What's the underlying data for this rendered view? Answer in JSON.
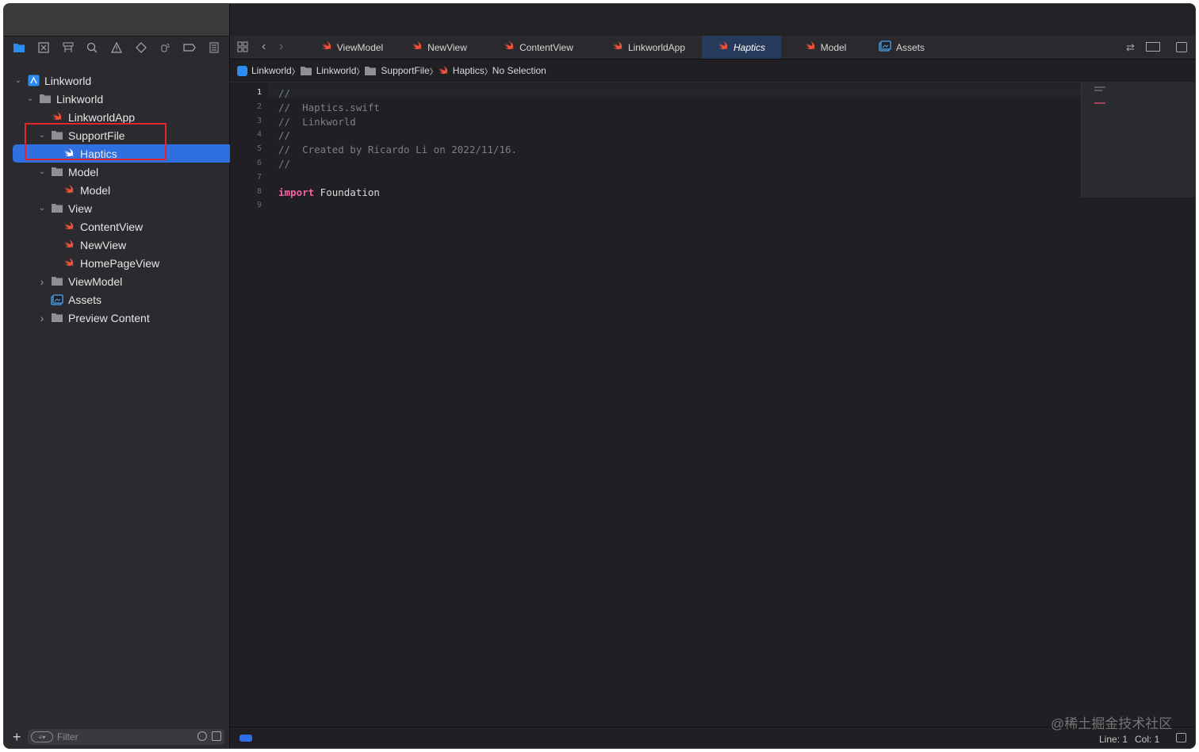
{
  "sidebar": {
    "toolbar_icons": [
      "folder-icon",
      "source-control-icon",
      "symbol-icon",
      "search-icon",
      "warning-icon",
      "test-icon",
      "debug-icon",
      "breakpoint-icon",
      "report-icon"
    ],
    "tree": [
      {
        "label": "Linkworld",
        "icon": "xcode-project-icon",
        "disclosure": "open"
      },
      {
        "label": "Linkworld",
        "icon": "folder-icon",
        "disclosure": "open"
      },
      {
        "label": "LinkworldApp",
        "icon": "swift-file-icon",
        "disclosure": ""
      },
      {
        "label": "SupportFile",
        "icon": "folder-icon",
        "disclosure": "open"
      },
      {
        "label": "Haptics",
        "icon": "swift-file-icon",
        "disclosure": "",
        "selected": true
      },
      {
        "label": "Model",
        "icon": "folder-icon",
        "disclosure": "open"
      },
      {
        "label": "Model",
        "icon": "swift-file-icon",
        "disclosure": ""
      },
      {
        "label": "View",
        "icon": "folder-icon",
        "disclosure": "open"
      },
      {
        "label": "ContentView",
        "icon": "swift-file-icon",
        "disclosure": ""
      },
      {
        "label": "NewView",
        "icon": "swift-file-icon",
        "disclosure": ""
      },
      {
        "label": "HomePageView",
        "icon": "swift-file-icon",
        "disclosure": ""
      },
      {
        "label": "ViewModel",
        "icon": "folder-icon",
        "disclosure": "closed"
      },
      {
        "label": "Assets",
        "icon": "asset-catalog-icon",
        "disclosure": ""
      },
      {
        "label": "Preview Content",
        "icon": "folder-icon",
        "disclosure": "closed"
      }
    ],
    "filter_placeholder": "Filter"
  },
  "tabs": [
    {
      "label": "ViewModel",
      "icon": "swift-file-icon"
    },
    {
      "label": "NewView",
      "icon": "swift-file-icon"
    },
    {
      "label": "ContentView",
      "icon": "swift-file-icon"
    },
    {
      "label": "LinkworldApp",
      "icon": "swift-file-icon"
    },
    {
      "label": "Haptics",
      "icon": "swift-file-icon",
      "active": true
    },
    {
      "label": "Model",
      "icon": "swift-file-icon"
    },
    {
      "label": "Assets",
      "icon": "asset-catalog-icon"
    }
  ],
  "breadcrumb": [
    "Linkworld",
    "Linkworld",
    "SupportFile",
    "Haptics",
    "No Selection"
  ],
  "code_lines": [
    {
      "n": "1",
      "text": "//"
    },
    {
      "n": "2",
      "text": "//  Haptics.swift"
    },
    {
      "n": "3",
      "text": "//  Linkworld"
    },
    {
      "n": "4",
      "text": "//"
    },
    {
      "n": "5",
      "text": "//  Created by Ricardo Li on 2022/11/16."
    },
    {
      "n": "6",
      "text": "//"
    },
    {
      "n": "7",
      "text": ""
    },
    {
      "n": "8",
      "keyword": "import",
      "text": " Foundation"
    },
    {
      "n": "9",
      "text": ""
    }
  ],
  "status": {
    "line_label": "Line: 1",
    "col_label": "Col: 1"
  },
  "watermark": "@稀土掘金技术社区",
  "colors": {
    "selection": "#2f6fe0",
    "swift": "#f05138",
    "keyword": "#fc5fa3",
    "highlight_box": "#e3262b"
  }
}
